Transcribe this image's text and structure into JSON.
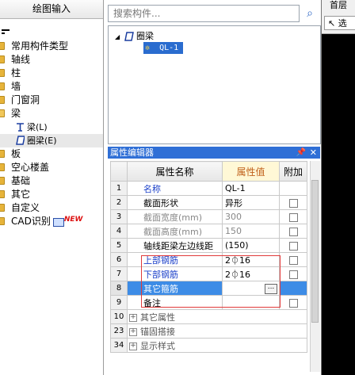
{
  "left_panel": {
    "title": "绘图输入",
    "tree": [
      {
        "label": "常用构件类型"
      },
      {
        "label": "轴线"
      },
      {
        "label": "柱"
      },
      {
        "label": "墙"
      },
      {
        "label": "门窗洞"
      },
      {
        "label": "梁",
        "expanded": true,
        "children": [
          {
            "label": "梁(L)",
            "icon": "beam-icon"
          },
          {
            "label": "圈梁(E)",
            "icon": "ring-beam-icon",
            "selected": true
          }
        ]
      },
      {
        "label": "板"
      },
      {
        "label": "空心楼盖"
      },
      {
        "label": "基础"
      },
      {
        "label": "其它"
      },
      {
        "label": "自定义"
      },
      {
        "label": "CAD识别",
        "badge": "NEW"
      }
    ]
  },
  "search": {
    "placeholder": "搜索构件...",
    "icon": "search-icon"
  },
  "component_tree": {
    "root": "圈梁",
    "child": "QL-1"
  },
  "property_editor": {
    "title": "属性编辑器",
    "columns": {
      "name": "属性名称",
      "value": "属性值",
      "extra": "附加"
    },
    "rows": [
      {
        "num": "1",
        "name": "名称",
        "value": "QL-1",
        "style": "blue",
        "checkbox": false
      },
      {
        "num": "2",
        "name": "截面形状",
        "value": "异形",
        "style": "normal",
        "checkbox": true
      },
      {
        "num": "3",
        "name": "截面宽度(mm)",
        "value": "300",
        "style": "gray",
        "checkbox": true
      },
      {
        "num": "4",
        "name": "截面高度(mm)",
        "value": "150",
        "style": "gray",
        "checkbox": true
      },
      {
        "num": "5",
        "name": "轴线距梁左边线距",
        "value": "(150)",
        "style": "normal",
        "checkbox": true
      },
      {
        "num": "6",
        "name": "上部钢筋",
        "value": "2⏀16",
        "style": "blue",
        "checkbox": true
      },
      {
        "num": "7",
        "name": "下部钢筋",
        "value": "2⏀16",
        "style": "blue",
        "checkbox": true
      },
      {
        "num": "8",
        "name": "其它箍筋",
        "value": "",
        "style": "selected",
        "checkbox": false
      },
      {
        "num": "9",
        "name": "备注",
        "value": "",
        "style": "normal",
        "checkbox": true
      },
      {
        "num": "10",
        "name": "其它属性",
        "value": "",
        "style": "group",
        "checkbox": false
      },
      {
        "num": "23",
        "name": "锚固搭接",
        "value": "",
        "style": "group",
        "checkbox": false
      },
      {
        "num": "34",
        "name": "显示样式",
        "value": "",
        "style": "group",
        "checkbox": false
      }
    ]
  },
  "right_panel": {
    "title": "首层",
    "select_label": "选"
  },
  "colors": {
    "selection": "#3d8ce6",
    "title_bar": "#2f6fd6",
    "highlight_box": "#e13a3a",
    "value_header": "#c0601a"
  }
}
